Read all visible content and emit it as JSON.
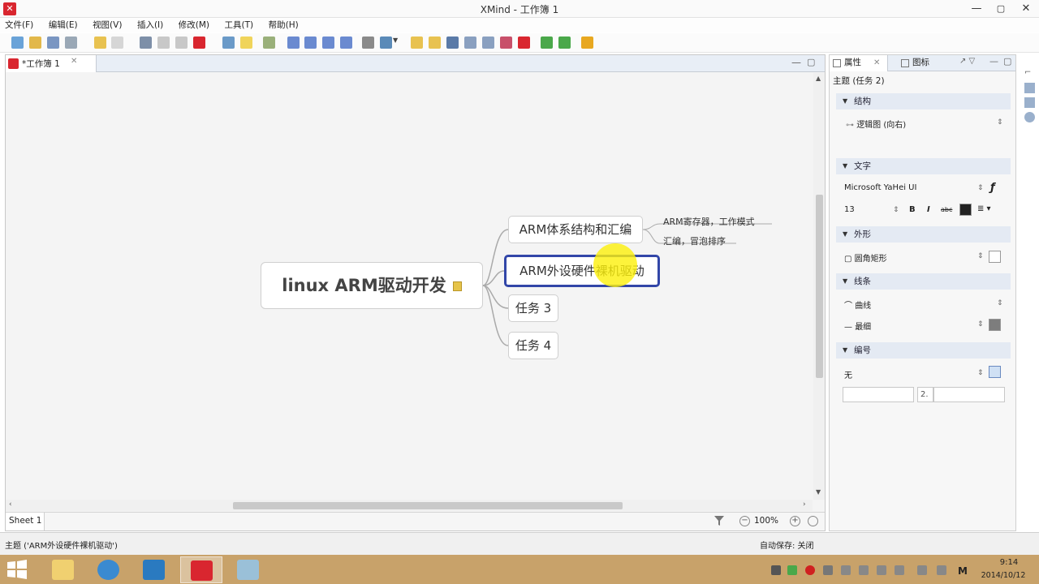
{
  "window": {
    "title": "XMind - 工作簿 1",
    "app_icon": "xmind-logo",
    "controls": {
      "minimize": "—",
      "maximize": "▢",
      "close": "✕"
    }
  },
  "menu": [
    "文件(F)",
    "编辑(E)",
    "视图(V)",
    "插入(I)",
    "修改(M)",
    "工具(T)",
    "帮助(H)"
  ],
  "editor": {
    "tab_label": "*工作簿 1",
    "tab_close": "✕",
    "sheet_tab": "Sheet 1",
    "zoom": "100%"
  },
  "mindmap": {
    "central_topic": "linux ARM驱动开发",
    "topics": [
      "ARM体系结构和汇编",
      "ARM外设硬件裸机驱动",
      "任务 3",
      "任务 4"
    ],
    "selected_topic_index": 1,
    "subtopics": [
      "ARM寄存器，工作模式",
      "汇编，冒泡排序"
    ]
  },
  "properties": {
    "tab_label": "属性",
    "icons_tab_label": "图标",
    "subject": "主题 (任务 2)",
    "sections": {
      "structure": {
        "title": "结构",
        "value": "逻辑图 (向右)"
      },
      "text": {
        "title": "文字",
        "font": "Microsoft YaHei UI",
        "size": "13",
        "bold": "B",
        "italic": "I",
        "strike": "abc"
      },
      "shape": {
        "title": "外形",
        "value": "圆角矩形"
      },
      "line": {
        "title": "线条",
        "curve": "曲线",
        "width": "最细"
      },
      "numbering": {
        "title": "编号",
        "value": "无",
        "separator": "2."
      }
    },
    "colors": {
      "text_color": "#222222",
      "line_color": "#7d7d7d",
      "fill_color": "#ffffff"
    }
  },
  "status": {
    "left": "主题 ('ARM外设硬件裸机驱动')",
    "autosave": "自动保存: 关闭"
  },
  "taskbar": {
    "time": "9:14",
    "date": "2014/10/12"
  },
  "colors": {
    "selection_border": "#3246a8",
    "cursor_highlight": "#fcf00a",
    "xmind_red": "#d9262f",
    "taskbar": "#c8a26a"
  }
}
